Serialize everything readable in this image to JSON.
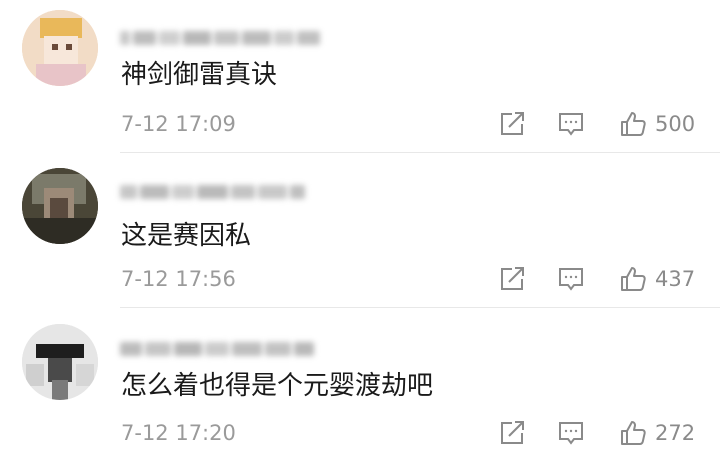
{
  "comments": [
    {
      "avatar_icon": "avatar-photo-blurred",
      "username_blurred": true,
      "text": "神剑御雷真诀",
      "time": "7-12 17:09",
      "likes": "500"
    },
    {
      "avatar_icon": "avatar-photo-blurred",
      "username_blurred": true,
      "text": "这是赛因私",
      "time": "7-12 17:56",
      "likes": "437"
    },
    {
      "avatar_icon": "avatar-photo-blurred",
      "username_blurred": true,
      "text": "怎么着也得是个元婴渡劫吧",
      "time": "7-12 17:20",
      "likes": "272"
    }
  ],
  "icons": {
    "share": "share-icon",
    "reply": "reply-icon",
    "like": "thumbs-up-icon"
  },
  "colors": {
    "text": "#1a1a1a",
    "meta": "#9a9a9a",
    "icon": "#8a8a8a",
    "divider": "#e8e8e8"
  }
}
